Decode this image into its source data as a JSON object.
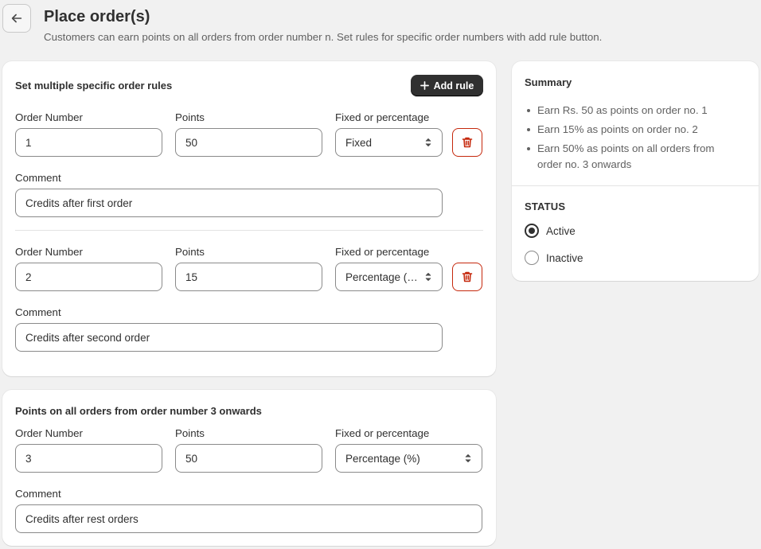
{
  "header": {
    "title": "Place order(s)",
    "subtitle": "Customers can earn points on all orders from order number n. Set rules for specific order numbers with add rule button."
  },
  "rules_card": {
    "title": "Set multiple specific order rules",
    "add_rule_label": "Add rule",
    "rules": [
      {
        "order_label": "Order Number",
        "order_value": "1",
        "points_label": "Points",
        "points_value": "50",
        "type_label": "Fixed or percentage",
        "type_value": "Fixed",
        "comment_label": "Comment",
        "comment_value": "Credits after first order"
      },
      {
        "order_label": "Order Number",
        "order_value": "2",
        "points_label": "Points",
        "points_value": "15",
        "type_label": "Fixed or percentage",
        "type_value": "Percentage (%)",
        "comment_label": "Comment",
        "comment_value": "Credits after second order"
      }
    ]
  },
  "onwards_card": {
    "title": "Points on all orders from order number 3 onwards",
    "order_label": "Order Number",
    "order_value": "3",
    "points_label": "Points",
    "points_value": "50",
    "type_label": "Fixed or percentage",
    "type_value": "Percentage (%)",
    "comment_label": "Comment",
    "comment_value": "Credits after rest orders"
  },
  "summary": {
    "title": "Summary",
    "items": [
      "Earn Rs. 50 as points on order no. 1",
      "Earn 15% as points on order no. 2",
      "Earn 50% as points on all orders from order no. 3 onwards"
    ],
    "status_heading": "STATUS",
    "status_options": [
      {
        "label": "Active",
        "checked": true
      },
      {
        "label": "Inactive",
        "checked": false
      }
    ]
  },
  "colors": {
    "page_bg": "#f1f1f1",
    "card_bg": "#ffffff",
    "primary_button": "#303030",
    "delete_red": "#c5280c",
    "input_border": "#8a8a8a"
  },
  "icons": {
    "back": "arrow-left-icon",
    "add": "plus-icon",
    "delete": "trash-icon",
    "select": "select-arrows-icon"
  }
}
